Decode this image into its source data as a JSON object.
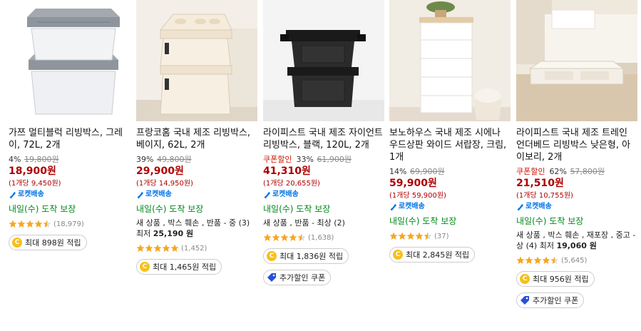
{
  "products": [
    {
      "title": "가쯔 멀티블럭 리빙박스, 그레이, 72L, 2개",
      "coupon_label": "",
      "discount": "4%",
      "original_price": "19,800원",
      "price": "18,900원",
      "unit_price": "(1개당 9,450원)",
      "rocket_label": "로켓배송",
      "delivery": "내일(수) 도착 보장",
      "used_offer": "",
      "used_offer_price": "",
      "rating": 4.5,
      "review_count": "(18,979)",
      "reward": "최대 898원 적립",
      "extra_coupon": ""
    },
    {
      "title": "프랑코홈 국내 제조 리빙박스, 베이지, 62L, 2개",
      "coupon_label": "",
      "discount": "39%",
      "original_price": "49,800원",
      "price": "29,900원",
      "unit_price": "(1개당 14,950원)",
      "rocket_label": "로켓배송",
      "delivery": "내일(수) 도착 보장",
      "used_offer": "새 상품 , 박스 훼손 , 반품 - 중 (3) 최저 ",
      "used_offer_price": "25,190 원",
      "rating": 5,
      "review_count": "(1,452)",
      "reward": "최대 1,465원 적립",
      "extra_coupon": ""
    },
    {
      "title": "라이피스트 국내 제조 자이언트 리빙박스, 블랙, 120L, 2개",
      "coupon_label": "쿠폰할인",
      "discount": "33%",
      "original_price": "61,900원",
      "price": "41,310원",
      "unit_price": "(1개당 20,655원)",
      "rocket_label": "로켓배송",
      "delivery": "내일(수) 도착 보장",
      "used_offer": "새 상품 , 반품 - 최상 (2)",
      "used_offer_price": "",
      "rating": 4.5,
      "review_count": "(1,638)",
      "reward": "최대 1,836원 적립",
      "extra_coupon": "추가할인 쿠폰"
    },
    {
      "title": "보노하우스 국내 제조 시에나 우드상판 와이드 서랍장, 크림, 1개",
      "coupon_label": "",
      "discount": "14%",
      "original_price": "69,900원",
      "price": "59,900원",
      "unit_price": "(1개당 59,900원)",
      "rocket_label": "로켓배송",
      "delivery": "내일(수) 도착 보장",
      "used_offer": "",
      "used_offer_price": "",
      "rating": 4.5,
      "review_count": "(37)",
      "reward": "최대 2,845원 적립",
      "extra_coupon": ""
    },
    {
      "title": "라이피스트 국내 제조 트레인 언더베드 리빙박스 낮은형, 아이보리, 2개",
      "coupon_label": "쿠폰할인",
      "discount": "62%",
      "original_price": "57,800원",
      "price": "21,510원",
      "unit_price": "(1개당 10,755원)",
      "rocket_label": "로켓배송",
      "delivery": "내일(수) 도착 보장",
      "used_offer": "새 상품 , 박스 훼손 , 재포장 , 중고 - 상 (4) 최저 ",
      "used_offer_price": "19,060 원",
      "rating": 4.5,
      "review_count": "(5,645)",
      "reward": "최대 956원 적립",
      "extra_coupon": "추가할인 쿠폰"
    }
  ],
  "colors": {
    "price": "#ae0000",
    "rocket": "#0073e9",
    "delivery": "#00891a",
    "star": "#f5a623"
  }
}
